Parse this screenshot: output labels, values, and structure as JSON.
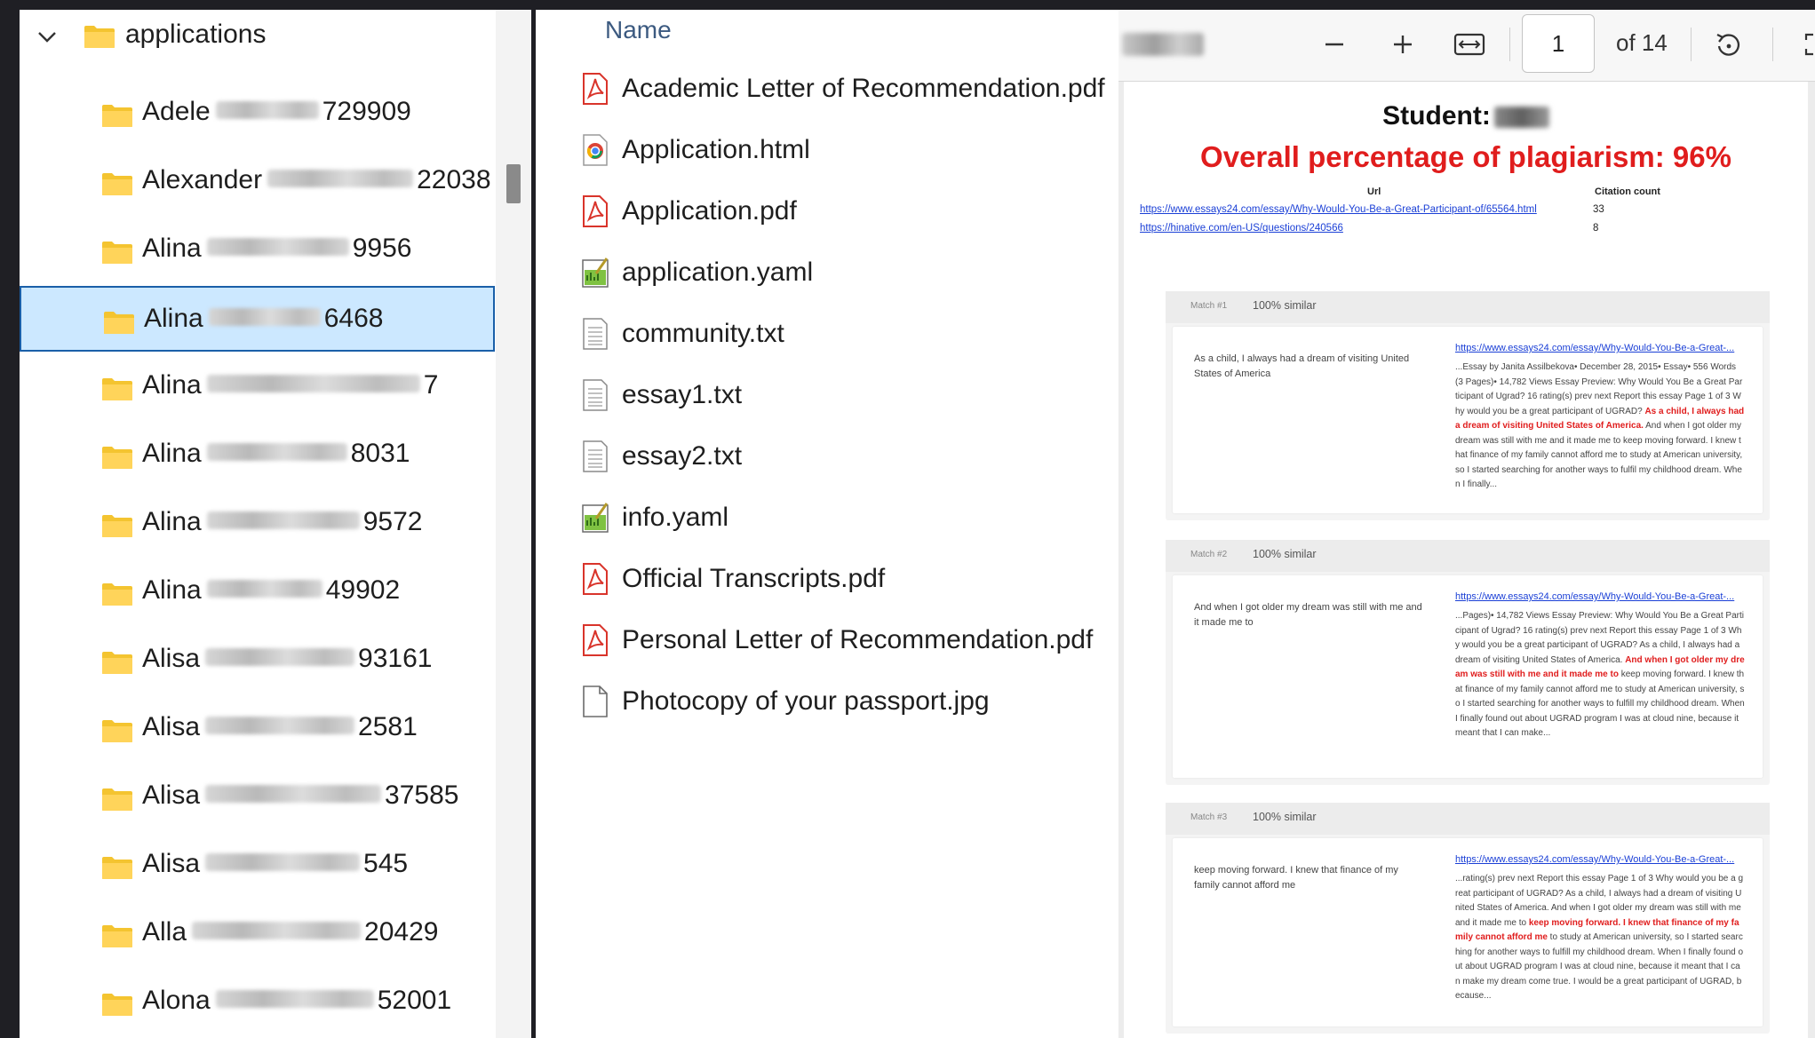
{
  "tree": {
    "root_label": "applications",
    "items": [
      {
        "first": "Adele",
        "suffix": "729909"
      },
      {
        "first": "Alexander",
        "suffix": "22038"
      },
      {
        "first": "Alina",
        "suffix": "9956"
      },
      {
        "first": "Alina",
        "suffix": "6468",
        "selected": true
      },
      {
        "first": "Alina",
        "suffix": "7"
      },
      {
        "first": "Alina",
        "suffix": "8031"
      },
      {
        "first": "Alina",
        "suffix": "9572"
      },
      {
        "first": "Alina",
        "suffix": "49902"
      },
      {
        "first": "Alisa",
        "suffix": "93161"
      },
      {
        "first": "Alisa",
        "suffix": "2581"
      },
      {
        "first": "Alisa",
        "suffix": "37585"
      },
      {
        "first": "Alisa",
        "suffix": "545"
      },
      {
        "first": "Alla",
        "suffix": "20429"
      },
      {
        "first": "Alona",
        "suffix": "52001"
      }
    ]
  },
  "files": {
    "column_header": "Name",
    "items": [
      {
        "name": "Academic Letter of Recommendation.pdf",
        "icon": "pdf-icon"
      },
      {
        "name": "Application.html",
        "icon": "chrome-html-icon"
      },
      {
        "name": "Application.pdf",
        "icon": "pdf-icon"
      },
      {
        "name": "application.yaml",
        "icon": "yaml-icon"
      },
      {
        "name": "community.txt",
        "icon": "text-file-icon"
      },
      {
        "name": "essay1.txt",
        "icon": "text-file-icon"
      },
      {
        "name": "essay2.txt",
        "icon": "text-file-icon"
      },
      {
        "name": "info.yaml",
        "icon": "yaml-icon"
      },
      {
        "name": "Official Transcripts.pdf",
        "icon": "pdf-icon"
      },
      {
        "name": "Personal Letter of Recommendation.pdf",
        "icon": "pdf-icon"
      },
      {
        "name": "Photocopy of your passport.jpg",
        "icon": "blank-file-icon"
      }
    ]
  },
  "viewer": {
    "page_number": "1",
    "page_total": "of 14",
    "student_label": "Student:",
    "overall_label": "Overall percentage of plagiarism: 96%",
    "table": {
      "url_header": "Url",
      "cite_header": "Citation count",
      "rows": [
        {
          "url": "https://www.essays24.com/essay/Why-Would-You-Be-a-Great-Participant-of/65564.html",
          "count": "33"
        },
        {
          "url": "https://hinative.com/en-US/questions/240566",
          "count": "8"
        }
      ]
    },
    "matches": [
      {
        "no": "Match #1",
        "sim": "100% similar",
        "left": "As a child, I always had a dream of visiting United States of America",
        "link": "https://www.essays24.com/essay/Why-Would-You-Be-a-Great-...",
        "pre": "...Essay by Janita Assilbekova• December 28, 2015• Essay• 556 Words (3 Pages)• 14,782 Views Essay Preview: Why Would You Be a Great Participant of Ugrad? 16 rating(s) prev next Report this essay Page 1 of 3 Why would you be a great participant of UGRAD? ",
        "hl": "As a child, I always had a dream of visiting United States of America.",
        "post": " And when I got older my dream was still with me and it made me to keep moving forward. I knew that finance of my family cannot afford me to study at American university, so I started searching for another ways to fulfil my childhood dream. When I finally..."
      },
      {
        "no": "Match #2",
        "sim": "100% similar",
        "left": "And when I got older my dream was still with me and it made me to",
        "link": "https://www.essays24.com/essay/Why-Would-You-Be-a-Great-...",
        "pre": "...Pages)• 14,782 Views Essay Preview: Why Would You Be a Great Participant of Ugrad? 16 rating(s) prev next Report this essay Page 1 of 3 Why would you be a great participant of UGRAD? As a child, I always had a dream of visiting United States of America. ",
        "hl": "And when I got older my dream was still with me and it made me to",
        "post": " keep moving forward. I knew that finance of my family cannot afford me to study at American university, so I started searching for another ways to fulfill my childhood dream. When I finally found out about UGRAD program I was at cloud nine, because it meant that I can make..."
      },
      {
        "no": "Match #3",
        "sim": "100% similar",
        "left": "keep moving forward. I knew that finance of my family cannot afford me",
        "link": "https://www.essays24.com/essay/Why-Would-You-Be-a-Great-...",
        "pre": "...rating(s) prev next Report this essay Page 1 of 3 Why would you be a great participant of UGRAD? As a child, I always had a dream of visiting United States of America. And when I got older my dream was still with me and it made me to ",
        "hl": "keep moving forward. I knew that finance of my family cannot afford me",
        "post": " to study at American university, so I started searching for another ways to fulfill my childhood dream. When I finally found out about UGRAD program I was at cloud nine, because it meant that I can make my dream come true. I would be a great participant of UGRAD, because..."
      }
    ]
  },
  "colors": {
    "folder": "#f4c430",
    "selected_bg": "#cce8ff",
    "alert_red": "#e01d1d",
    "link_blue": "#1a3fd6"
  }
}
